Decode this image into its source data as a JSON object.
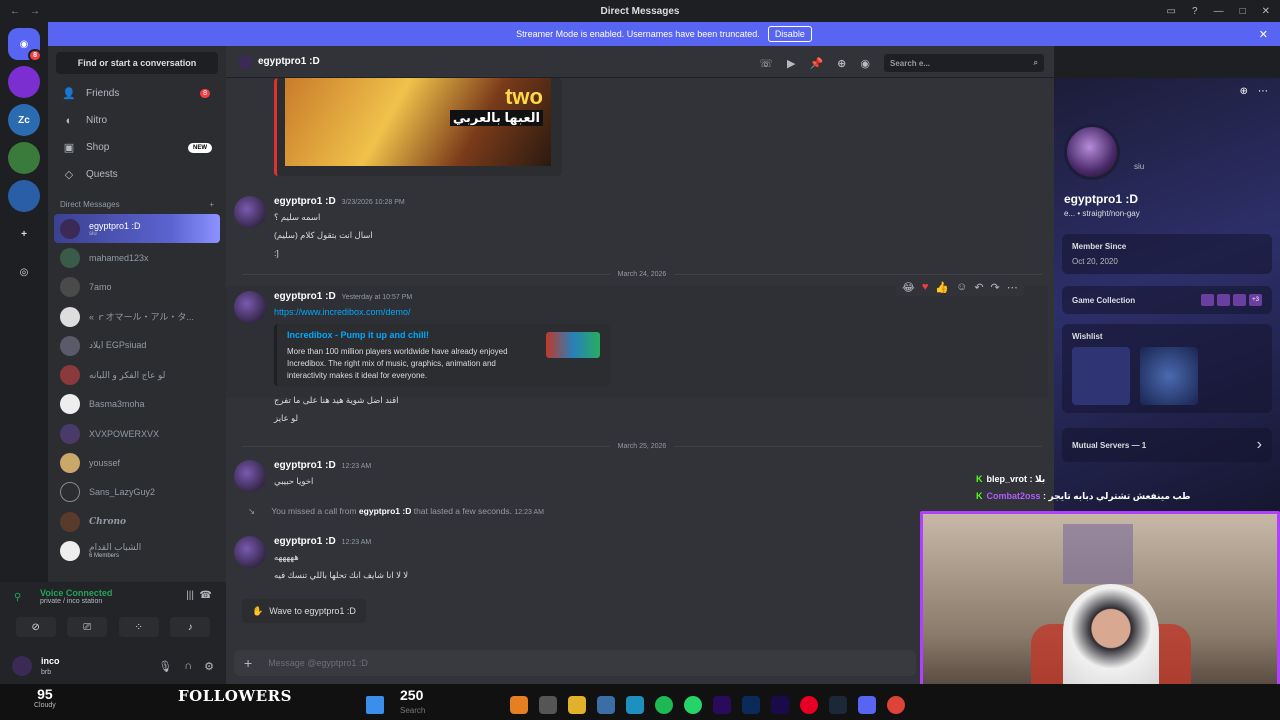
{
  "window": {
    "title": "Direct Messages"
  },
  "banner": {
    "text": "Streamer Mode is enabled. Usernames have been truncated.",
    "button": "Disable"
  },
  "servers": [
    {
      "label": "",
      "badge": "8",
      "icon": "discord-logo-icon"
    },
    {
      "label": "",
      "icon": "server-icon"
    },
    {
      "label": "Zc",
      "icon": "server-icon"
    },
    {
      "label": "",
      "icon": "server-icon"
    },
    {
      "label": "",
      "icon": "server-icon"
    },
    {
      "label": "+",
      "icon": "add-server-icon"
    },
    {
      "label": "",
      "icon": "discover-icon"
    }
  ],
  "dm_column": {
    "find_button": "Find or start a conversation",
    "nav": [
      {
        "label": "Friends",
        "icon": "friends-icon",
        "badge": "8"
      },
      {
        "label": "Nitro",
        "icon": "nitro-icon"
      },
      {
        "label": "Shop",
        "icon": "shop-icon",
        "tag": "NEW"
      },
      {
        "label": "Quests",
        "icon": "quests-icon"
      }
    ],
    "dm_header": "Direct Messages",
    "dms": [
      {
        "name": "egyptpro1 :D",
        "sub": "siu",
        "active": true
      },
      {
        "name": "mahamed123x"
      },
      {
        "name": "7amo"
      },
      {
        "name": "« ｒオマール・アル・タ..."
      },
      {
        "name": "ايلاد EGPsiuad"
      },
      {
        "name": "لو عاج الفكر و اللبانه"
      },
      {
        "name": "Basma3moha"
      },
      {
        "name": "XVXPOWERXVX"
      },
      {
        "name": "youssef"
      },
      {
        "name": "Sans_LazyGuy2"
      },
      {
        "name": "Chrono"
      },
      {
        "name": "الشباب القدام",
        "sub": "6 Members"
      }
    ]
  },
  "voice": {
    "status": "Voice Connected",
    "sub": "private / inco station"
  },
  "user": {
    "name": "inco",
    "status": "brb"
  },
  "chat": {
    "header_name": "egyptpro1 :D",
    "search_placeholder": "Search e...",
    "image_text_1": "two",
    "image_text_2": "العبها بالعربي",
    "messages": {
      "m1": {
        "name": "egyptpro1 :D",
        "time": "3/23/2026 10:28 PM",
        "lines": [
          "اسمه سليم ؟",
          "اسال انت بتقول كلام (سليم)",
          ":]"
        ]
      },
      "divider1": "March 24, 2026",
      "m2": {
        "name": "egyptpro1 :D",
        "time": "Yesterday at 10:57 PM",
        "link": "https://www.incredibox.com/demo/",
        "embed_title": "Incredibox - Pump it up and chill!",
        "embed_desc": "More than 100 million players worldwide have already enjoyed Incredibox. The right mix of music, graphics, animation and interactivity makes it ideal for everyone.",
        "lines": [
          "اقند اضل شوية هيد هنا على ما تفرج",
          "لو عايز"
        ]
      },
      "divider2": "March 25, 2026",
      "m3": {
        "name": "egyptpro1 :D",
        "time": "12:23 AM",
        "lines": [
          "اخويا حبيبي"
        ]
      },
      "call": {
        "prefix": "You missed a call from",
        "name": "egyptpro1 :D",
        "suffix": "that lasted a few seconds.",
        "time": "12:23 AM"
      },
      "m4": {
        "name": "egyptpro1 :D",
        "time": "12:23 AM",
        "lines": [
          "هههههه",
          "لا لا انا شايف انك تحلها باللي تنسك فيه"
        ]
      }
    },
    "wave": "Wave to egyptpro1 :D",
    "composer_placeholder": "Message @egyptpro1 :D"
  },
  "profile": {
    "name": "egyptpro1 :D",
    "status": "siu",
    "bio": "e... • straight/non-gay",
    "member_since_label": "Member Since",
    "member_since": "Oct 20, 2020",
    "game_collection": "Game Collection",
    "game_extra": "+3",
    "wishlist": "Wishlist",
    "mutual": "Mutual Servers — 1"
  },
  "stream_chat": [
    {
      "user": "blep_vrot",
      "text": "بلا"
    },
    {
      "user": "Combat2oss",
      "text": "طب مينفعش تشترلي دبابه تايجر"
    }
  ],
  "taskbar": {
    "temp": "95",
    "weather": "Cloudy",
    "followers_label": "FOLLOWERS",
    "followers_count": "250",
    "search": "Search"
  },
  "colors": {
    "accent": "#5865f2",
    "link": "#00a8fc",
    "voice": "#23a55a",
    "danger": "#f23f43"
  }
}
